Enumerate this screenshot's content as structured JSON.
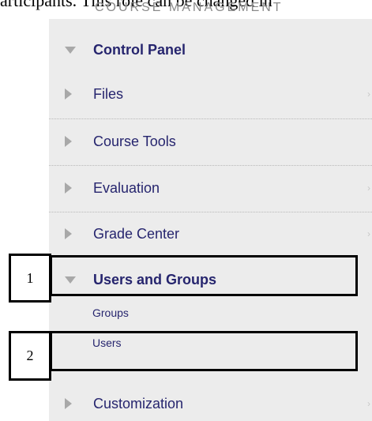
{
  "header": {
    "partial_text": "articipants. This role can be changed in",
    "section_label": "COURSE MANAGEMENT"
  },
  "control_panel": {
    "title": "Control Panel",
    "items": [
      {
        "label": "Files"
      },
      {
        "label": "Course Tools"
      },
      {
        "label": "Evaluation"
      },
      {
        "label": "Grade Center"
      },
      {
        "label": "Users and Groups"
      },
      {
        "label": "Customization"
      }
    ],
    "sub_items": [
      {
        "label": "Groups"
      },
      {
        "label": "Users"
      }
    ]
  },
  "callouts": [
    {
      "number": "1"
    },
    {
      "number": "2"
    }
  ],
  "colors": {
    "panel_bg": "#ececec",
    "link_text": "#26256e",
    "arrow": "#a8a8a8",
    "callout_border": "#000000"
  },
  "icons": {
    "expand": "triangle-right-icon",
    "collapse": "triangle-down-icon",
    "chevron": "chevron-right-icon"
  }
}
